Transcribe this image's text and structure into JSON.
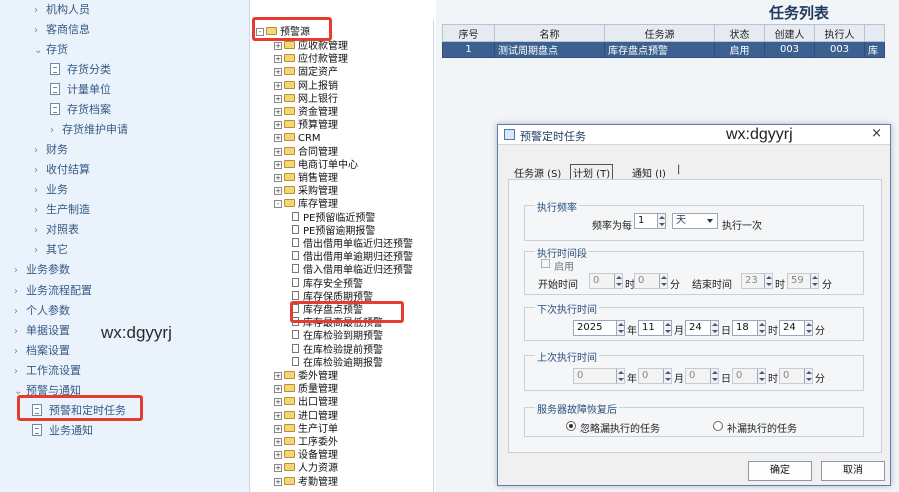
{
  "nav": {
    "items": [
      {
        "label": "机构人员",
        "arrow": "›",
        "kind": "arrow"
      },
      {
        "label": "客商信息",
        "arrow": "›",
        "kind": "arrow"
      },
      {
        "label": "存货",
        "arrow": "⌄",
        "kind": "arrow"
      },
      {
        "label": "存货分类",
        "kind": "page"
      },
      {
        "label": "计量单位",
        "kind": "page"
      },
      {
        "label": "存货档案",
        "kind": "page"
      },
      {
        "label": "存货维护申请",
        "arrow": "›",
        "kind": "arrow"
      },
      {
        "label": "财务",
        "arrow": "›",
        "kind": "arrow"
      },
      {
        "label": "收付结算",
        "arrow": "›",
        "kind": "arrow"
      },
      {
        "label": "业务",
        "arrow": "›",
        "kind": "arrow"
      },
      {
        "label": "生产制造",
        "arrow": "›",
        "kind": "arrow"
      },
      {
        "label": "对照表",
        "arrow": "›",
        "kind": "arrow"
      },
      {
        "label": "其它",
        "arrow": "›",
        "kind": "arrow"
      },
      {
        "label": "业务参数",
        "arrow": "›",
        "kind": "arrow"
      },
      {
        "label": "业务流程配置",
        "arrow": "›",
        "kind": "arrow"
      },
      {
        "label": "个人参数",
        "arrow": "›",
        "kind": "arrow"
      },
      {
        "label": "单据设置",
        "arrow": "›",
        "kind": "arrow"
      },
      {
        "label": "档案设置",
        "arrow": "›",
        "kind": "arrow"
      },
      {
        "label": "工作流设置",
        "arrow": "›",
        "kind": "arrow"
      },
      {
        "label": "预警与通知",
        "arrow": "⌄",
        "kind": "arrow"
      },
      {
        "label": "预警和定时任务",
        "kind": "page"
      },
      {
        "label": "业务通知",
        "kind": "page"
      }
    ],
    "watermark": "wx:dgyyrj"
  },
  "tree": {
    "root": "预警源",
    "nodes": [
      {
        "label": "应收款管理",
        "type": "folder"
      },
      {
        "label": "应付款管理",
        "type": "folder"
      },
      {
        "label": "固定资产",
        "type": "folder"
      },
      {
        "label": "网上报销",
        "type": "folder"
      },
      {
        "label": "网上银行",
        "type": "folder"
      },
      {
        "label": "资金管理",
        "type": "folder"
      },
      {
        "label": "预算管理",
        "type": "folder"
      },
      {
        "label": "CRM",
        "type": "folder"
      },
      {
        "label": "合同管理",
        "type": "folder"
      },
      {
        "label": "电商订单中心",
        "type": "folder"
      },
      {
        "label": "销售管理",
        "type": "folder"
      },
      {
        "label": "采购管理",
        "type": "folder"
      },
      {
        "label": "库存管理",
        "type": "folder-open"
      },
      {
        "label": "PE预留临近预警",
        "type": "leaf"
      },
      {
        "label": "PE预留逾期报警",
        "type": "leaf"
      },
      {
        "label": "借出借用单临近归还预警",
        "type": "leaf"
      },
      {
        "label": "借出借用单逾期归还预警",
        "type": "leaf"
      },
      {
        "label": "借入借用单临近归还预警",
        "type": "leaf"
      },
      {
        "label": "库存安全预警",
        "type": "leaf"
      },
      {
        "label": "库存保质期预警",
        "type": "leaf"
      },
      {
        "label": "库存盘点预警",
        "type": "leaf"
      },
      {
        "label": "库存最高最低预警",
        "type": "leaf"
      },
      {
        "label": "在库检验到期预警",
        "type": "leaf"
      },
      {
        "label": "在库检验提前预警",
        "type": "leaf"
      },
      {
        "label": "在库检验逾期报警",
        "type": "leaf"
      },
      {
        "label": "委外管理",
        "type": "folder"
      },
      {
        "label": "质量管理",
        "type": "folder"
      },
      {
        "label": "出口管理",
        "type": "folder"
      },
      {
        "label": "进口管理",
        "type": "folder"
      },
      {
        "label": "生产订单",
        "type": "folder"
      },
      {
        "label": "工序委外",
        "type": "folder"
      },
      {
        "label": "设备管理",
        "type": "folder"
      },
      {
        "label": "人力资源",
        "type": "folder"
      },
      {
        "label": "考勤管理",
        "type": "folder"
      }
    ]
  },
  "tasklist": {
    "title": "任务列表",
    "columns": [
      "序号",
      "名称",
      "任务源",
      "状态",
      "创建人",
      "执行人",
      ""
    ],
    "rows": [
      {
        "cells": [
          "1",
          "测试周期盘点",
          "库存盘点预警",
          "启用",
          "003",
          "003",
          "库"
        ]
      }
    ]
  },
  "dialog": {
    "title": "预警定时任务",
    "watermark": "wx:dgyyrj",
    "close": "×",
    "tabs": [
      "任务源 (S)",
      "计划 (T)",
      "通知 (I)"
    ],
    "freq": {
      "legend": "执行频率",
      "label": "频率为每",
      "value": "1",
      "unit": "天",
      "suffix": "执行一次"
    },
    "period": {
      "legend": "执行时间段",
      "enable": "启用",
      "start_label": "开始时间",
      "start_h": "0",
      "start_m": "0",
      "end_label": "结束时间",
      "end_h": "23",
      "end_m": "59",
      "hour": "时",
      "minute": "分"
    },
    "next": {
      "legend": "下次执行时间",
      "year": "2025",
      "month": "11",
      "day": "24",
      "hour": "18",
      "minute": "24",
      "u_year": "年",
      "u_month": "月",
      "u_day": "日",
      "u_hour": "时",
      "u_minute": "分"
    },
    "last": {
      "legend": "上次执行时间",
      "year": "0",
      "month": "0",
      "day": "0",
      "hour": "0",
      "minute": "0",
      "u_year": "年",
      "u_month": "月",
      "u_day": "日",
      "u_hour": "时",
      "u_minute": "分"
    },
    "recover": {
      "legend": "服务器故障恢复后",
      "opt1": "忽略漏执行的任务",
      "opt2": "补漏执行的任务"
    },
    "ok": "确定",
    "cancel": "取消"
  }
}
